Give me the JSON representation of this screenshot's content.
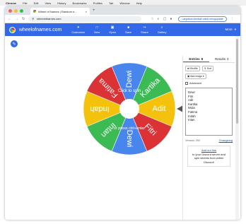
{
  "menubar": {
    "apple": "",
    "items": [
      "Chrome",
      "File",
      "Edit",
      "View",
      "History",
      "Bookmarks",
      "Profiles",
      "Tab",
      "Window",
      "Help"
    ]
  },
  "browser": {
    "tab_title": "Wheel of Names | Random n...",
    "new_tab": "+",
    "url": "wheelofnames.com",
    "resume_label": "Lanjutkan kembali untuk mengupdate",
    "traffic": [
      "#ff5f57",
      "#febc2e",
      "#28c840"
    ]
  },
  "app": {
    "site_name": "wheelofnames.com",
    "toolbar": [
      {
        "label": "Customize",
        "icon": "palette-icon",
        "glyph": "✦"
      },
      {
        "label": "New",
        "icon": "new-file-icon",
        "glyph": "□"
      },
      {
        "label": "Open",
        "icon": "folder-icon",
        "glyph": "▣"
      },
      {
        "label": "Save",
        "icon": "save-icon",
        "glyph": "■"
      },
      {
        "label": "Share",
        "icon": "share-icon",
        "glyph": "↪"
      },
      {
        "label": "Gallery",
        "icon": "search-icon",
        "glyph": "⌕"
      }
    ],
    "more_label": "More",
    "brand_color": "#3369e8"
  },
  "wheel": {
    "center_text": "Click to spin",
    "center_subtext": "or press ctrl+enter",
    "slices": [
      {
        "name": "Kartika",
        "color": "#3cba54"
      },
      {
        "name": "Adit",
        "color": "#f4c20d"
      },
      {
        "name": "Fitri",
        "color": "#db3236"
      },
      {
        "name": "Dewi",
        "color": "#4885ed"
      },
      {
        "name": "Intan",
        "color": "#3cba54"
      },
      {
        "name": "Indah",
        "color": "#f4c20d"
      },
      {
        "name": "Fatima",
        "color": "#db3236"
      },
      {
        "name": "Dewi",
        "color": "#4885ed"
      }
    ]
  },
  "sidebar": {
    "tab_entries": "Entries",
    "entries_count": "8",
    "tab_results": "Results",
    "results_count": "0",
    "shuffle": "Shuffle",
    "sort": "Sort",
    "add_image": "Add image",
    "advanced": "Advanced",
    "entries": [
      "Dewi",
      "Fitri",
      "Adit",
      "Kartika",
      "Wida",
      "Fatima",
      "Indah",
      "Intan"
    ],
    "version": "Version 292",
    "changelog": "Changelog",
    "promo_link": "Add our link",
    "promo_text": "to your Discord server and spin wheels from within Discord!"
  }
}
